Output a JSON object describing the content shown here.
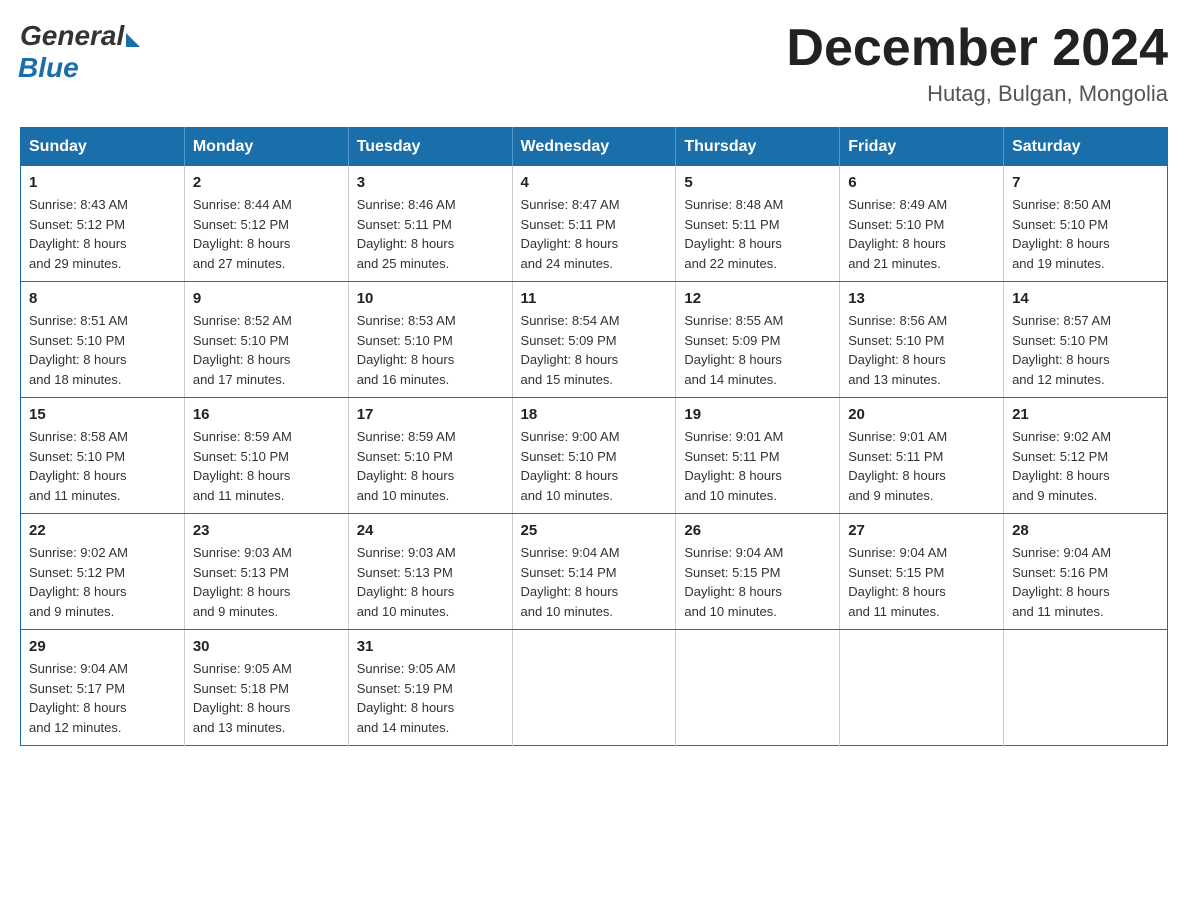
{
  "logo": {
    "general": "General",
    "blue": "Blue"
  },
  "title": "December 2024",
  "subtitle": "Hutag, Bulgan, Mongolia",
  "days_of_week": [
    "Sunday",
    "Monday",
    "Tuesday",
    "Wednesday",
    "Thursday",
    "Friday",
    "Saturday"
  ],
  "weeks": [
    [
      {
        "day": "1",
        "sunrise": "8:43 AM",
        "sunset": "5:12 PM",
        "daylight": "8 hours and 29 minutes."
      },
      {
        "day": "2",
        "sunrise": "8:44 AM",
        "sunset": "5:12 PM",
        "daylight": "8 hours and 27 minutes."
      },
      {
        "day": "3",
        "sunrise": "8:46 AM",
        "sunset": "5:11 PM",
        "daylight": "8 hours and 25 minutes."
      },
      {
        "day": "4",
        "sunrise": "8:47 AM",
        "sunset": "5:11 PM",
        "daylight": "8 hours and 24 minutes."
      },
      {
        "day": "5",
        "sunrise": "8:48 AM",
        "sunset": "5:11 PM",
        "daylight": "8 hours and 22 minutes."
      },
      {
        "day": "6",
        "sunrise": "8:49 AM",
        "sunset": "5:10 PM",
        "daylight": "8 hours and 21 minutes."
      },
      {
        "day": "7",
        "sunrise": "8:50 AM",
        "sunset": "5:10 PM",
        "daylight": "8 hours and 19 minutes."
      }
    ],
    [
      {
        "day": "8",
        "sunrise": "8:51 AM",
        "sunset": "5:10 PM",
        "daylight": "8 hours and 18 minutes."
      },
      {
        "day": "9",
        "sunrise": "8:52 AM",
        "sunset": "5:10 PM",
        "daylight": "8 hours and 17 minutes."
      },
      {
        "day": "10",
        "sunrise": "8:53 AM",
        "sunset": "5:10 PM",
        "daylight": "8 hours and 16 minutes."
      },
      {
        "day": "11",
        "sunrise": "8:54 AM",
        "sunset": "5:09 PM",
        "daylight": "8 hours and 15 minutes."
      },
      {
        "day": "12",
        "sunrise": "8:55 AM",
        "sunset": "5:09 PM",
        "daylight": "8 hours and 14 minutes."
      },
      {
        "day": "13",
        "sunrise": "8:56 AM",
        "sunset": "5:10 PM",
        "daylight": "8 hours and 13 minutes."
      },
      {
        "day": "14",
        "sunrise": "8:57 AM",
        "sunset": "5:10 PM",
        "daylight": "8 hours and 12 minutes."
      }
    ],
    [
      {
        "day": "15",
        "sunrise": "8:58 AM",
        "sunset": "5:10 PM",
        "daylight": "8 hours and 11 minutes."
      },
      {
        "day": "16",
        "sunrise": "8:59 AM",
        "sunset": "5:10 PM",
        "daylight": "8 hours and 11 minutes."
      },
      {
        "day": "17",
        "sunrise": "8:59 AM",
        "sunset": "5:10 PM",
        "daylight": "8 hours and 10 minutes."
      },
      {
        "day": "18",
        "sunrise": "9:00 AM",
        "sunset": "5:10 PM",
        "daylight": "8 hours and 10 minutes."
      },
      {
        "day": "19",
        "sunrise": "9:01 AM",
        "sunset": "5:11 PM",
        "daylight": "8 hours and 10 minutes."
      },
      {
        "day": "20",
        "sunrise": "9:01 AM",
        "sunset": "5:11 PM",
        "daylight": "8 hours and 9 minutes."
      },
      {
        "day": "21",
        "sunrise": "9:02 AM",
        "sunset": "5:12 PM",
        "daylight": "8 hours and 9 minutes."
      }
    ],
    [
      {
        "day": "22",
        "sunrise": "9:02 AM",
        "sunset": "5:12 PM",
        "daylight": "8 hours and 9 minutes."
      },
      {
        "day": "23",
        "sunrise": "9:03 AM",
        "sunset": "5:13 PM",
        "daylight": "8 hours and 9 minutes."
      },
      {
        "day": "24",
        "sunrise": "9:03 AM",
        "sunset": "5:13 PM",
        "daylight": "8 hours and 10 minutes."
      },
      {
        "day": "25",
        "sunrise": "9:04 AM",
        "sunset": "5:14 PM",
        "daylight": "8 hours and 10 minutes."
      },
      {
        "day": "26",
        "sunrise": "9:04 AM",
        "sunset": "5:15 PM",
        "daylight": "8 hours and 10 minutes."
      },
      {
        "day": "27",
        "sunrise": "9:04 AM",
        "sunset": "5:15 PM",
        "daylight": "8 hours and 11 minutes."
      },
      {
        "day": "28",
        "sunrise": "9:04 AM",
        "sunset": "5:16 PM",
        "daylight": "8 hours and 11 minutes."
      }
    ],
    [
      {
        "day": "29",
        "sunrise": "9:04 AM",
        "sunset": "5:17 PM",
        "daylight": "8 hours and 12 minutes."
      },
      {
        "day": "30",
        "sunrise": "9:05 AM",
        "sunset": "5:18 PM",
        "daylight": "8 hours and 13 minutes."
      },
      {
        "day": "31",
        "sunrise": "9:05 AM",
        "sunset": "5:19 PM",
        "daylight": "8 hours and 14 minutes."
      },
      null,
      null,
      null,
      null
    ]
  ],
  "labels": {
    "sunrise": "Sunrise:",
    "sunset": "Sunset:",
    "daylight": "Daylight:"
  }
}
